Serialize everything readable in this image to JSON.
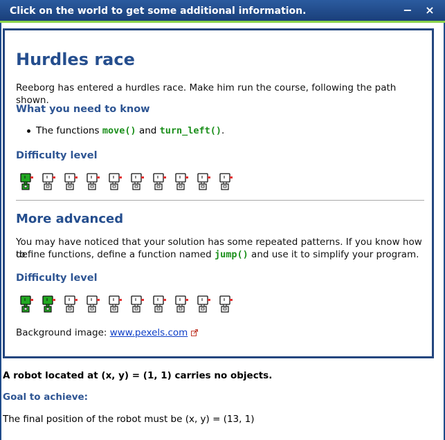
{
  "titlebar": {
    "title": "Click on the world to get some additional information.",
    "minimize_glyph": "−",
    "close_glyph": "×"
  },
  "panel": {
    "title": "Hurdles race",
    "intro": "Reeborg has entered a hurdles race. Make him run the course, following the path shown.",
    "need_heading": "What you need to know",
    "bullet_prefix": "The functions ",
    "bullet_code1": "move()",
    "bullet_mid": " and ",
    "bullet_code2": "turn_left()",
    "bullet_suffix": ".",
    "difficulty_heading_1": "Difficulty level",
    "difficulty_1": {
      "level": 1,
      "max": 10
    },
    "advanced_heading": "More advanced",
    "advanced_text_1": "You may have noticed that your solution has some repeated patterns. If you know how to",
    "advanced_text_2_prefix": "define functions, define a function named ",
    "advanced_code": "jump()",
    "advanced_text_2_suffix": " and use it to simplify your program.",
    "difficulty_heading_2": "Difficulty level",
    "difficulty_2": {
      "level": 2,
      "max": 10
    },
    "background_label": "Background image: ",
    "background_link": "www.pexels.com"
  },
  "info": {
    "robot_status": "A robot located at (x, y) = (1, 1) carries no objects.",
    "goal_heading": "Goal to achieve:",
    "goal_text": "The final position of the robot must be (x, y) = (13, 1)"
  },
  "colors": {
    "active_robot": "#22aa22",
    "inactive_robot": "#ffffff",
    "heading": "#2e5593",
    "title": "#254e8e",
    "code": "#1b8f1b",
    "link": "#0d3ec7",
    "titlebar": "#1a3f7a",
    "titlebar_accent": "#8ad34a"
  },
  "icons": {
    "robot": "reeborg-robot-icon",
    "external_link": "external-link-icon"
  }
}
